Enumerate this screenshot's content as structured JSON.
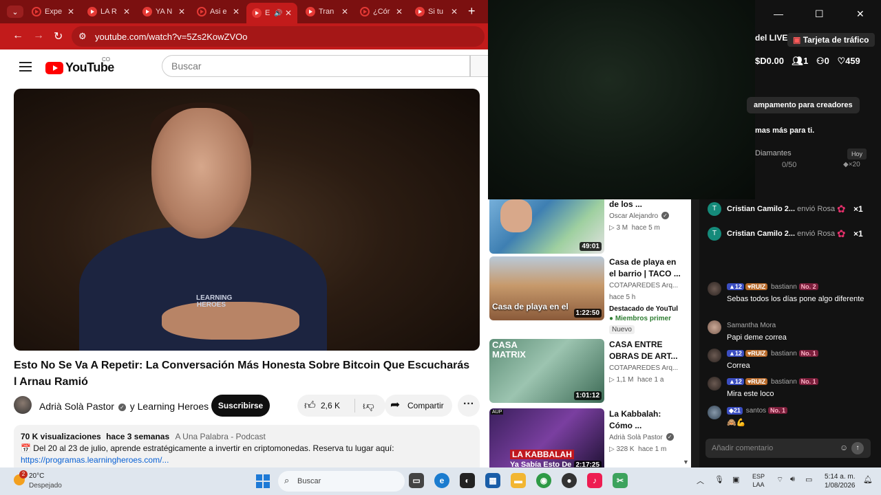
{
  "browser": {
    "tabs": [
      {
        "label": "Expe"
      },
      {
        "label": "LA R"
      },
      {
        "label": "YA N"
      },
      {
        "label": "Asi e"
      },
      {
        "label": "E"
      },
      {
        "label": "Tran"
      },
      {
        "label": "¿Cór"
      },
      {
        "label": "Si tu"
      }
    ],
    "url": "youtube.com/watch?v=5Zs2KowZVOo"
  },
  "youtube": {
    "logo_text": "YouTube",
    "country": "CO",
    "search_placeholder": "Buscar",
    "video_title": "Esto No Se Va A Repetir: La Conversación Más Honesta Sobre Bitcoin Que Escucharás l Arnau Ramió",
    "channel": "Adrià Solà Pastor",
    "channel_joint": "y Learning Heroes",
    "subscribe_label": "Suscribirse",
    "likes": "2,6 K",
    "share_label": "Compartir",
    "video_shirt_text": "LEARNING HEROES",
    "description": {
      "views": "70 K visualizaciones",
      "date": "hace 3 semanas",
      "tag": "A Una Palabra - Podcast",
      "line1": "Del 20 al 23 de julio, aprende estratégicamente a invertir en criptomonedas. Reserva tu lugar aquí:",
      "link": "https://programas.learningheroes.com/..."
    },
    "recommendations": [
      {
        "title": "de los ...",
        "channel": "Oscar Alejandro",
        "views": "3 M",
        "age": "hace 5 m",
        "duration": "49:01"
      },
      {
        "title": "Casa de playa en el barrio | TACO ...",
        "channel": "COTAPAREDES Arq...",
        "age": "hace 5 h",
        "featured": "Destacado de YouTul",
        "members": "Miembros primer",
        "new": "Nuevo",
        "duration": "1:22:50",
        "thumb_text": "Casa de playa en el"
      },
      {
        "title": "CASA ENTRE OBRAS DE ART...",
        "channel": "COTAPAREDES Arq...",
        "views": "1,1 M",
        "age": "hace 1 a",
        "duration": "1:01:12",
        "thumb_text": "CASA MATRIX"
      },
      {
        "title": "La Kabbalah: Cómo ...",
        "channel": "Adrià Solà Pastor",
        "views": "328 K",
        "age": "hace 1 m",
        "duration": "2:17:25",
        "thumb_text": "LA KABBALAH",
        "thumb_sub": "Ya Sabía Esto De",
        "thumb_badge": "AUP"
      }
    ]
  },
  "live": {
    "live_label": "del LIVE",
    "traffic_card": "Tarjeta de tráfico",
    "coins": "$D0.00",
    "viewers": "1",
    "followers": "0",
    "likes": "459",
    "camp": "ampamento para creadores",
    "more_text": "mas más para ti.",
    "diamonds_label": "Diamantes",
    "today_label": "Hoy",
    "diamonds_progress": "0/50",
    "diamonds_mult": "×20",
    "gifts": [
      {
        "initial": "T",
        "name": "Cristian Camilo 2...",
        "action": "envió Rosa",
        "mult": "×1"
      },
      {
        "initial": "T",
        "name": "Cristian Camilo 2...",
        "action": "envió Rosa",
        "mult": "×1"
      }
    ],
    "chat": [
      {
        "level": "12",
        "fan": "RUIZ",
        "user": "bastiann",
        "rank": "No. 2",
        "message": "Sebas todos los días pone algo diferente"
      },
      {
        "user": "Samantha Mora",
        "message": "Papi deme correa"
      },
      {
        "level": "12",
        "fan": "RUIZ",
        "user": "bastiann",
        "rank": "No. 1",
        "message": "Correa"
      },
      {
        "level": "12",
        "fan": "RUIZ",
        "user": "bastiann",
        "rank": "No. 1",
        "message": "Mira este loco"
      },
      {
        "level": "21",
        "user": "santos",
        "rank": "No. 1",
        "message": "🙈💪"
      }
    ],
    "comment_placeholder": "Añadir comentario"
  },
  "taskbar": {
    "weather_temp": "20°C",
    "weather_cond": "Despejado",
    "weather_notif": "2",
    "search_label": "Buscar",
    "lang_line1": "ESP",
    "lang_line2": "LAA",
    "time": "5:14 a. m.",
    "date": "1/08/2026"
  }
}
